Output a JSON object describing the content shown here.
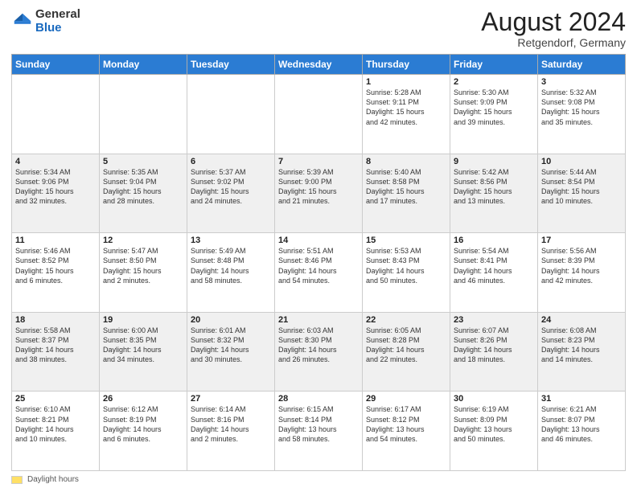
{
  "header": {
    "logo_general": "General",
    "logo_blue": "Blue",
    "month_year": "August 2024",
    "location": "Retgendorf, Germany"
  },
  "calendar": {
    "days_of_week": [
      "Sunday",
      "Monday",
      "Tuesday",
      "Wednesday",
      "Thursday",
      "Friday",
      "Saturday"
    ],
    "weeks": [
      [
        {
          "day": "",
          "detail": ""
        },
        {
          "day": "",
          "detail": ""
        },
        {
          "day": "",
          "detail": ""
        },
        {
          "day": "",
          "detail": ""
        },
        {
          "day": "1",
          "detail": "Sunrise: 5:28 AM\nSunset: 9:11 PM\nDaylight: 15 hours\nand 42 minutes."
        },
        {
          "day": "2",
          "detail": "Sunrise: 5:30 AM\nSunset: 9:09 PM\nDaylight: 15 hours\nand 39 minutes."
        },
        {
          "day": "3",
          "detail": "Sunrise: 5:32 AM\nSunset: 9:08 PM\nDaylight: 15 hours\nand 35 minutes."
        }
      ],
      [
        {
          "day": "4",
          "detail": "Sunrise: 5:34 AM\nSunset: 9:06 PM\nDaylight: 15 hours\nand 32 minutes."
        },
        {
          "day": "5",
          "detail": "Sunrise: 5:35 AM\nSunset: 9:04 PM\nDaylight: 15 hours\nand 28 minutes."
        },
        {
          "day": "6",
          "detail": "Sunrise: 5:37 AM\nSunset: 9:02 PM\nDaylight: 15 hours\nand 24 minutes."
        },
        {
          "day": "7",
          "detail": "Sunrise: 5:39 AM\nSunset: 9:00 PM\nDaylight: 15 hours\nand 21 minutes."
        },
        {
          "day": "8",
          "detail": "Sunrise: 5:40 AM\nSunset: 8:58 PM\nDaylight: 15 hours\nand 17 minutes."
        },
        {
          "day": "9",
          "detail": "Sunrise: 5:42 AM\nSunset: 8:56 PM\nDaylight: 15 hours\nand 13 minutes."
        },
        {
          "day": "10",
          "detail": "Sunrise: 5:44 AM\nSunset: 8:54 PM\nDaylight: 15 hours\nand 10 minutes."
        }
      ],
      [
        {
          "day": "11",
          "detail": "Sunrise: 5:46 AM\nSunset: 8:52 PM\nDaylight: 15 hours\nand 6 minutes."
        },
        {
          "day": "12",
          "detail": "Sunrise: 5:47 AM\nSunset: 8:50 PM\nDaylight: 15 hours\nand 2 minutes."
        },
        {
          "day": "13",
          "detail": "Sunrise: 5:49 AM\nSunset: 8:48 PM\nDaylight: 14 hours\nand 58 minutes."
        },
        {
          "day": "14",
          "detail": "Sunrise: 5:51 AM\nSunset: 8:46 PM\nDaylight: 14 hours\nand 54 minutes."
        },
        {
          "day": "15",
          "detail": "Sunrise: 5:53 AM\nSunset: 8:43 PM\nDaylight: 14 hours\nand 50 minutes."
        },
        {
          "day": "16",
          "detail": "Sunrise: 5:54 AM\nSunset: 8:41 PM\nDaylight: 14 hours\nand 46 minutes."
        },
        {
          "day": "17",
          "detail": "Sunrise: 5:56 AM\nSunset: 8:39 PM\nDaylight: 14 hours\nand 42 minutes."
        }
      ],
      [
        {
          "day": "18",
          "detail": "Sunrise: 5:58 AM\nSunset: 8:37 PM\nDaylight: 14 hours\nand 38 minutes."
        },
        {
          "day": "19",
          "detail": "Sunrise: 6:00 AM\nSunset: 8:35 PM\nDaylight: 14 hours\nand 34 minutes."
        },
        {
          "day": "20",
          "detail": "Sunrise: 6:01 AM\nSunset: 8:32 PM\nDaylight: 14 hours\nand 30 minutes."
        },
        {
          "day": "21",
          "detail": "Sunrise: 6:03 AM\nSunset: 8:30 PM\nDaylight: 14 hours\nand 26 minutes."
        },
        {
          "day": "22",
          "detail": "Sunrise: 6:05 AM\nSunset: 8:28 PM\nDaylight: 14 hours\nand 22 minutes."
        },
        {
          "day": "23",
          "detail": "Sunrise: 6:07 AM\nSunset: 8:26 PM\nDaylight: 14 hours\nand 18 minutes."
        },
        {
          "day": "24",
          "detail": "Sunrise: 6:08 AM\nSunset: 8:23 PM\nDaylight: 14 hours\nand 14 minutes."
        }
      ],
      [
        {
          "day": "25",
          "detail": "Sunrise: 6:10 AM\nSunset: 8:21 PM\nDaylight: 14 hours\nand 10 minutes."
        },
        {
          "day": "26",
          "detail": "Sunrise: 6:12 AM\nSunset: 8:19 PM\nDaylight: 14 hours\nand 6 minutes."
        },
        {
          "day": "27",
          "detail": "Sunrise: 6:14 AM\nSunset: 8:16 PM\nDaylight: 14 hours\nand 2 minutes."
        },
        {
          "day": "28",
          "detail": "Sunrise: 6:15 AM\nSunset: 8:14 PM\nDaylight: 13 hours\nand 58 minutes."
        },
        {
          "day": "29",
          "detail": "Sunrise: 6:17 AM\nSunset: 8:12 PM\nDaylight: 13 hours\nand 54 minutes."
        },
        {
          "day": "30",
          "detail": "Sunrise: 6:19 AM\nSunset: 8:09 PM\nDaylight: 13 hours\nand 50 minutes."
        },
        {
          "day": "31",
          "detail": "Sunrise: 6:21 AM\nSunset: 8:07 PM\nDaylight: 13 hours\nand 46 minutes."
        }
      ]
    ]
  },
  "legend": {
    "label": "Daylight hours"
  }
}
